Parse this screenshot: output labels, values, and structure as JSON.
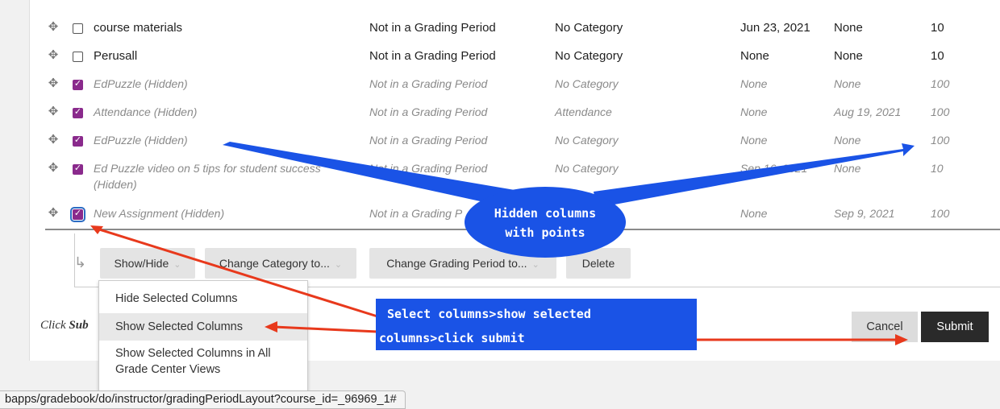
{
  "rows": [
    {
      "name": "course materials",
      "period": "Not in a Grading Period",
      "category": "No Category",
      "date1": "Jun 23, 2021",
      "date2": "None",
      "points": "10",
      "hidden": false,
      "checked": false
    },
    {
      "name": "Perusall",
      "period": "Not in a Grading Period",
      "category": "No Category",
      "date1": "None",
      "date2": "None",
      "points": "10",
      "hidden": false,
      "checked": false
    },
    {
      "name": "EdPuzzle (Hidden)",
      "period": "Not in a Grading Period",
      "category": "No Category",
      "date1": "None",
      "date2": "None",
      "points": "100",
      "hidden": true,
      "checked": true
    },
    {
      "name": "Attendance (Hidden)",
      "period": "Not in a Grading Period",
      "category": "Attendance",
      "date1": "None",
      "date2": "Aug 19, 2021",
      "points": "100",
      "hidden": true,
      "checked": true
    },
    {
      "name": "EdPuzzle (Hidden)",
      "period": "Not in a Grading Period",
      "category": "No Category",
      "date1": "None",
      "date2": "None",
      "points": "100",
      "hidden": true,
      "checked": true
    },
    {
      "name": "Ed Puzzle video on 5 tips for student success",
      "name2": "(Hidden)",
      "period": "Not in a Grading Period",
      "category": "No Category",
      "date1": "Sep 16, 2021",
      "date2": "None",
      "points": "10",
      "hidden": true,
      "checked": true
    },
    {
      "name": "New Assignment (Hidden)",
      "period": "Not in a Grading P",
      "category": "",
      "date1": "None",
      "date2": "Sep 9, 2021",
      "points": "100",
      "hidden": true,
      "checked": true
    }
  ],
  "toolbar": {
    "show_hide": "Show/Hide",
    "change_category": "Change Category to...",
    "change_period": "Change Grading Period to...",
    "delete": "Delete"
  },
  "menu": {
    "items": [
      "Hide Selected Columns",
      "Show Selected Columns",
      "Show Selected Columns in All",
      "Grade Center Views"
    ]
  },
  "click_text": {
    "prefix": "Click ",
    "bold": "Sub"
  },
  "buttons": {
    "cancel": "Cancel",
    "submit": "Submit"
  },
  "status_url": "bapps/gradebook/do/instructor/gradingPeriodLayout?course_id=_96969_1#",
  "annotations": {
    "bubble_line1": "Hidden columns",
    "bubble_line2": "with points",
    "box_line1": "Select columns>show selected",
    "box_line2": "columns>click submit"
  },
  "colors": {
    "annotation_blue": "#1a53e6",
    "arrow_red": "#e8391c",
    "checkbox_purple": "#8a2a8c"
  }
}
